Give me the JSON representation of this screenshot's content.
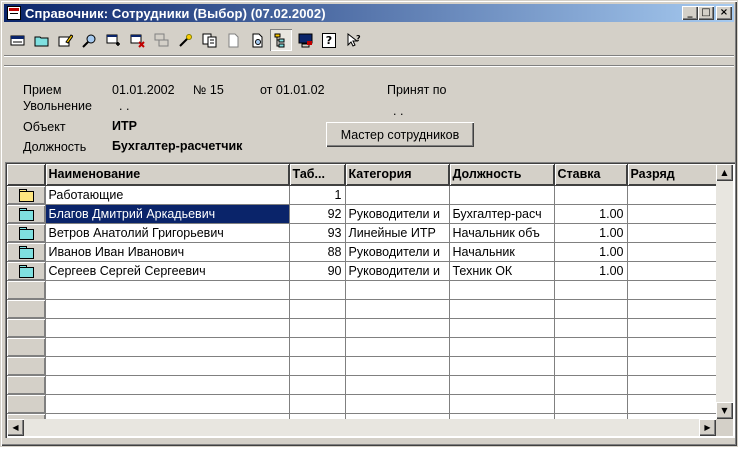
{
  "window": {
    "title": "Справочник: Сотрудники (Выбор) (07.02.2002)",
    "minimize_label": "_",
    "maximize_label": "□",
    "close_label": "×"
  },
  "toolbar": {
    "help_label": "?"
  },
  "info": {
    "hire_label": "Прием",
    "hire_date": "01.01.2002",
    "order_no": "№ 15",
    "order_from": "от 01.01.02",
    "accepted_label": "Принят по",
    "accepted_value": ". .",
    "dismissal_label": "Увольнение",
    "dismissal_value": ". .",
    "object_label": "Объект",
    "object_value": "ИТР",
    "position_label": "Должность",
    "position_value": "Бухгалтер-расчетчик"
  },
  "master_button": "Мастер сотрудников",
  "grid": {
    "columns": [
      "Наименование",
      "Таб...",
      "Категория",
      "Должность",
      "Ставка",
      "Разряд"
    ],
    "rows": [
      {
        "icon": "yellow-folder-icon",
        "name": "Работающие",
        "tab": "1",
        "category": "",
        "position": "",
        "rate": "",
        "grade": ""
      },
      {
        "icon": "cyan-folder-icon",
        "name": "Благов Дмитрий Аркадьевич",
        "tab": "92",
        "category": "Руководители и",
        "position": "Бухгалтер-расч",
        "rate": "1.00",
        "grade": "",
        "selected": true
      },
      {
        "icon": "cyan-folder-icon",
        "name": "Ветров Анатолий Григорьевич",
        "tab": "93",
        "category": "Линейные ИТР",
        "position": "Начальник объ",
        "rate": "1.00",
        "grade": ""
      },
      {
        "icon": "cyan-folder-icon",
        "name": "Иванов Иван Иванович",
        "tab": "88",
        "category": "Руководители и",
        "position": "Начальник",
        "rate": "1.00",
        "grade": ""
      },
      {
        "icon": "cyan-folder-icon",
        "name": "Сергеев Сергей Сергеевич",
        "tab": "90",
        "category": "Руководители и",
        "position": "Техник ОК",
        "rate": "1.00",
        "grade": ""
      }
    ]
  },
  "colors": {
    "titlebar_start": "#0a246a",
    "titlebar_end": "#a6caf0",
    "face": "#d4d0c8",
    "selection": "#0a246a"
  }
}
